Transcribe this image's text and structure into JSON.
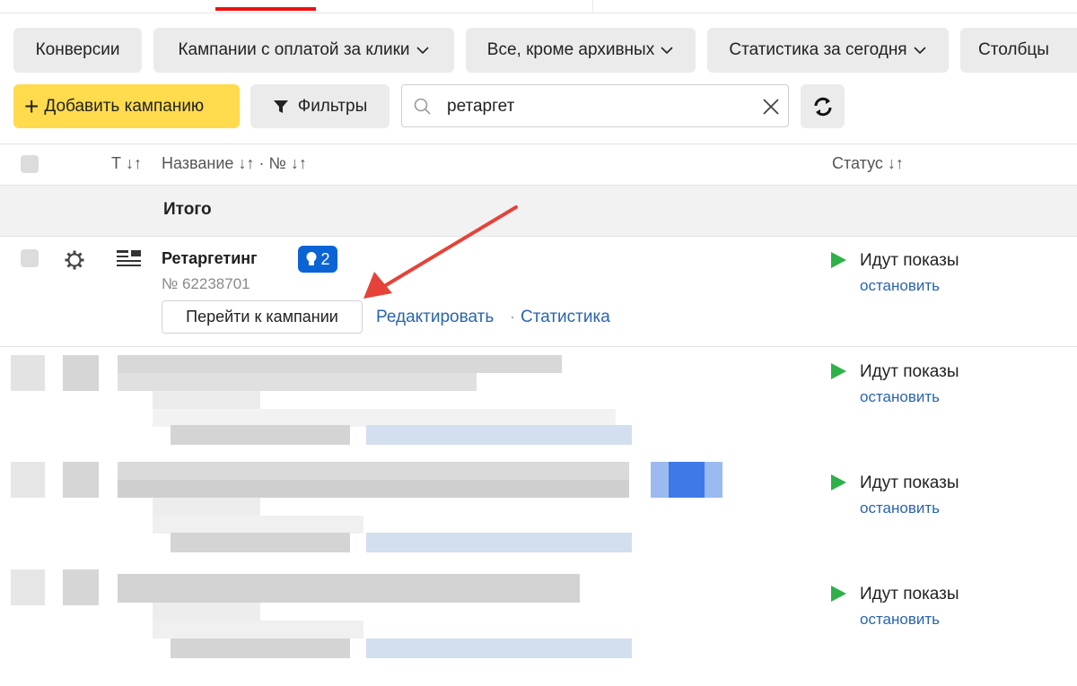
{
  "toolbar": {
    "conversions": "Конверсии",
    "campaigns_filter": "Кампании с оплатой за клики",
    "archive_filter": "Все, кроме архивных",
    "stats_filter": "Статистика за сегодня",
    "columns": "Столбцы"
  },
  "actions": {
    "add_campaign": "Добавить кампанию",
    "filters": "Фильтры",
    "search_value": "ретаргет"
  },
  "table": {
    "col_type": "Т",
    "col_name": "Название",
    "col_sep": "·",
    "col_num": "№",
    "col_status": "Статус",
    "total_label": "Итого"
  },
  "campaign": {
    "name": "Ретаргетинг",
    "badge_count": "2",
    "number": "№ 62238701",
    "goto_label": "Перейти к кампании",
    "edit_label": "Редактировать",
    "sep": "·",
    "stats_label": "Статистика"
  },
  "statuses": [
    {
      "text": "Идут показы",
      "action": "остановить"
    },
    {
      "text": "Идут показы",
      "action": "остановить"
    },
    {
      "text": "Идут показы",
      "action": "остановить"
    },
    {
      "text": "Идут показы",
      "action": "остановить"
    }
  ],
  "colors": {
    "accent_yellow": "#ffdb4d",
    "badge_blue": "#0a64d6",
    "link_blue": "#2a64ad",
    "status_green": "#2fb14a",
    "arrow_red": "#e5433a"
  }
}
